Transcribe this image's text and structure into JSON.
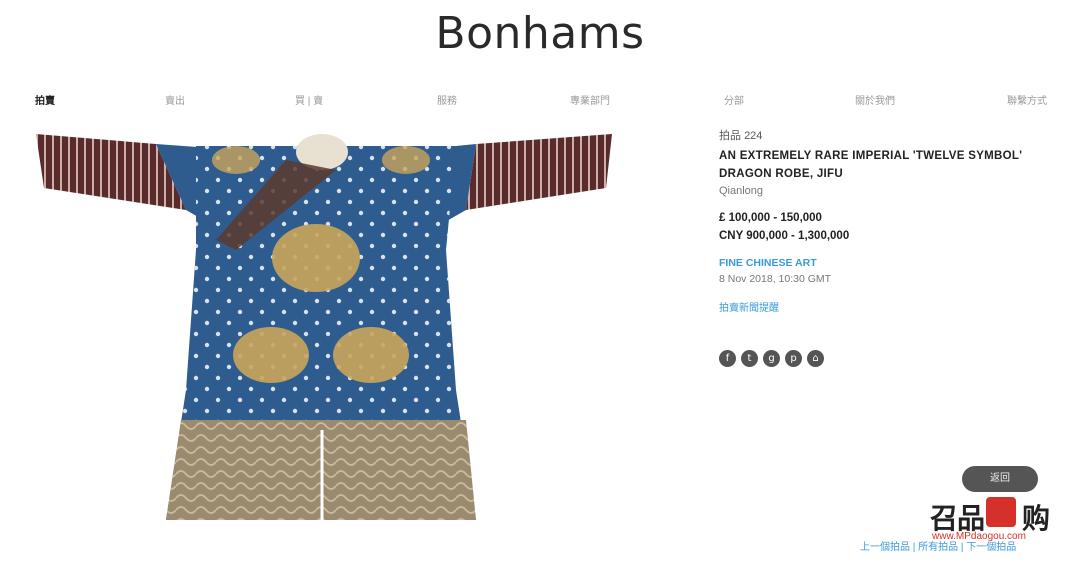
{
  "header": {
    "logo": "Bonhams"
  },
  "nav": {
    "items": [
      {
        "label": "拍賣",
        "active": true
      },
      {
        "label": "賣出",
        "active": false
      },
      {
        "label": "買 | 賣",
        "active": false
      },
      {
        "label": "服務",
        "active": false
      },
      {
        "label": "專業部門",
        "active": false
      },
      {
        "label": "分部",
        "active": false
      },
      {
        "label": "關於我們",
        "active": false
      },
      {
        "label": "聯繫方式",
        "active": false
      }
    ]
  },
  "lot": {
    "lot_prefix": "拍品",
    "lot_number": "224",
    "title_line1": "AN EXTREMELY RARE IMPERIAL 'TWELVE SYMBOL'",
    "title_line2": "DRAGON ROBE, JIFU",
    "period": "Qianlong",
    "estimate_gbp": "£ 100,000 - 150,000",
    "estimate_cny": "CNY 900,000 - 1,300,000",
    "department": "FINE CHINESE ART",
    "date": "8 Nov 2018, 10:30 GMT",
    "watch_label": "拍賣新聞提醒"
  },
  "social": {
    "icons": [
      {
        "name": "facebook-icon",
        "glyph": "f"
      },
      {
        "name": "twitter-icon",
        "glyph": "t"
      },
      {
        "name": "google-plus-icon",
        "glyph": "g"
      },
      {
        "name": "pinterest-icon",
        "glyph": "p"
      },
      {
        "name": "share-icon",
        "glyph": "⌂"
      }
    ]
  },
  "actions": {
    "back_label": "返回"
  },
  "pager": {
    "prev": "上一個拍品",
    "sep1": " | ",
    "all": "所有拍品",
    "sep2": " | ",
    "next": "下一個拍品"
  },
  "watermark": {
    "text": "召品",
    "suffix": "购",
    "url": "www.MPdaogou.com"
  },
  "colors": {
    "link": "#3a9ad9",
    "robe_blue": "#2e5c8f",
    "gold": "#c9a55a",
    "sleeve": "#5a2a2e"
  }
}
